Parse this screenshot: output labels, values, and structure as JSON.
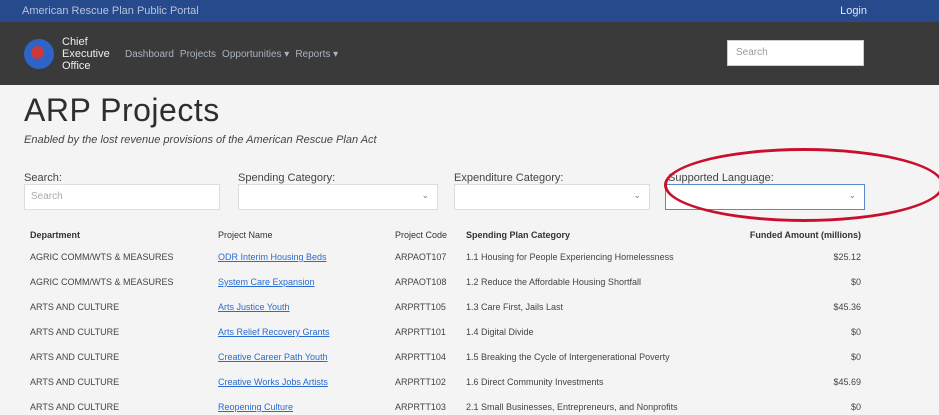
{
  "topbar": {
    "portal": "American Rescue Plan Public Portal",
    "login": "Login"
  },
  "brand": {
    "line1": "Chief",
    "line2": "Executive",
    "line3": "Office"
  },
  "nav": [
    "Dashboard",
    "Projects",
    "Opportunities ▾",
    "Reports ▾"
  ],
  "top_search": {
    "placeholder": "Search"
  },
  "page": {
    "title": "ARP Projects",
    "subtitle": "Enabled by the lost revenue provisions of the American Rescue Plan Act"
  },
  "filters": {
    "search_label": "Search:",
    "search_placeholder": "Search",
    "spending_label": "Spending Category:",
    "expenditure_label": "Expenditure Category:",
    "language_label": "Supported Language:"
  },
  "table": {
    "headers": [
      "Department",
      "Project Name",
      "Project Code",
      "Spending Plan Category",
      "Funded Amount (millions)"
    ],
    "rows": [
      [
        "AGRIC COMM/WTS & MEASURES",
        "ODR Interim Housing Beds",
        "ARPAOT107",
        "1.1 Housing for People Experiencing Homelessness",
        "$25.12"
      ],
      [
        "AGRIC COMM/WTS & MEASURES",
        "System Care Expansion",
        "ARPAOT108",
        "1.2 Reduce the Affordable Housing Shortfall",
        "$0"
      ],
      [
        "ARTS AND CULTURE",
        "Arts Justice Youth",
        "ARPRTT105",
        "1.3 Care First, Jails Last",
        "$45.36"
      ],
      [
        "ARTS AND CULTURE",
        "Arts Relief Recovery Grants",
        "ARPRTT101",
        "1.4 Digital Divide",
        "$0"
      ],
      [
        "ARTS AND CULTURE",
        "Creative Career Path Youth",
        "ARPRTT104",
        "1.5 Breaking the Cycle of Intergenerational Poverty",
        "$0"
      ],
      [
        "ARTS AND CULTURE",
        "Creative Works Jobs Artists",
        "ARPRTT102",
        "1.6 Direct Community Investments",
        "$45.69"
      ],
      [
        "ARTS AND CULTURE",
        "Reopening Culture",
        "ARPRTT103",
        "2.1 Small Businesses, Entrepreneurs, and Nonprofits",
        "$0"
      ]
    ]
  },
  "colors": {
    "topbar": "#274a8c",
    "navbar": "#3a3a3a",
    "link": "#2a6bd1",
    "annotation": "#c8102e"
  }
}
